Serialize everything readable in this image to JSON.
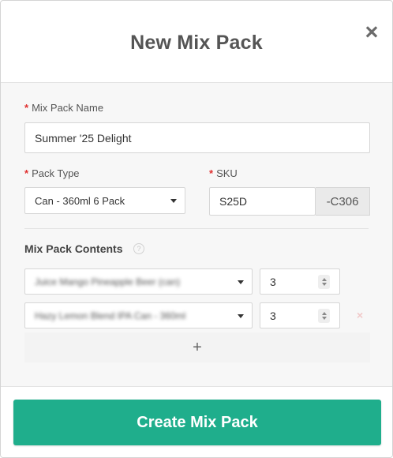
{
  "modal": {
    "title": "New Mix Pack"
  },
  "form": {
    "name": {
      "label": "Mix Pack Name",
      "value": "Summer '25 Delight"
    },
    "pack_type": {
      "label": "Pack Type",
      "value": "Can - 360ml 6 Pack"
    },
    "sku": {
      "label": "SKU",
      "value": "S25D",
      "suffix": "-C306"
    }
  },
  "contents": {
    "title": "Mix Pack Contents",
    "items": [
      {
        "product": "Juice Mango Pineapple Beer (can)",
        "quantity": "3"
      },
      {
        "product": "Hazy Lemon Blend IPA Can - 360ml",
        "quantity": "3"
      }
    ]
  },
  "footer": {
    "create_label": "Create Mix Pack"
  },
  "colors": {
    "accent": "#1fae8c",
    "required": "#e0302f"
  }
}
